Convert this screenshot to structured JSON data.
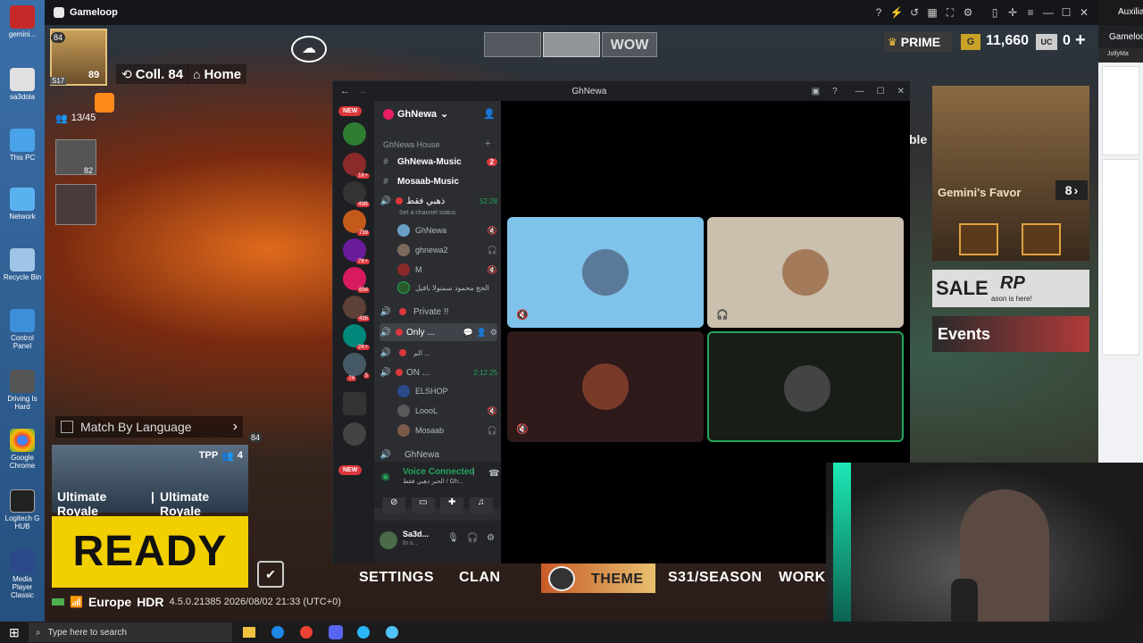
{
  "game_window": {
    "title": "Gameloop"
  },
  "aux_window": {
    "title": "Auxilia",
    "header": "Gameloo",
    "tab": "JollyMa"
  },
  "desktop_icons": [
    {
      "label": "gemini..."
    },
    {
      "label": "sa3dola"
    },
    {
      "label": "This PC"
    },
    {
      "label": "Network"
    },
    {
      "label": "Recycle Bin"
    },
    {
      "label": "Control Panel"
    },
    {
      "label": "Driving Is Hard"
    },
    {
      "label": "Google Chrome"
    },
    {
      "label": "Logitech G HUB"
    },
    {
      "label": "Media Player Classic"
    }
  ],
  "game_hud": {
    "player_level": "84",
    "player_rank": "89",
    "season": "S17",
    "coll": "Coll. 84",
    "home": "Home",
    "party": "13/45",
    "slot_level": "82",
    "prime": "PRIME",
    "uc_bp": "11,660",
    "uc": "0",
    "match_by_language": "Match By Language",
    "mode_tag": "TPP",
    "squad": "4",
    "mode_1": "Ultimate Royale",
    "mode_2": "Ultimate Royale",
    "ready": "READY",
    "server": "Europe",
    "hdr": "HDR",
    "version": "4.5.0.21385 2026/08/02 21:33 (UTC+0)",
    "top_tab": "WOW",
    "gemini_favor": "Gemini's Favor",
    "gemini_count": "8",
    "sale": "SALE",
    "rp": "RP",
    "rp_sub": "ason is here!",
    "events": "Events",
    "side_text": "ble",
    "menu": [
      "SETTINGS",
      "CLAN",
      "THEME",
      "S31/SEASON",
      "WORKSH"
    ]
  },
  "discord": {
    "window_title": "GhNewa",
    "server_name": "GhNewa",
    "category": "GhNewa House",
    "new_badge": "NEW",
    "channels": [
      {
        "name": "GhNewa-Music",
        "badge": "2"
      },
      {
        "name": "Mosaab-Music"
      }
    ],
    "voice_1": {
      "name": "ذهبي فقط",
      "time": "52:28",
      "status": "Set a channel status"
    },
    "voice_1_users": [
      "GhNewa",
      "ghnewa2",
      "M",
      "الحج محمود سمنولا بافيل"
    ],
    "voice_private": "Private !!",
    "voice_only": "Only ...",
    "voice_ar": "الم ...",
    "voice_on": {
      "name": "ON ...",
      "time": "2:12:25"
    },
    "voice_on_users": [
      "ELSHOP",
      "LoooL",
      "Mosaab"
    ],
    "voice_ghnewa": "GhNewa",
    "guild_badges": [
      "1K+",
      "49B",
      "739",
      "7K+",
      "654",
      "435",
      "2K+",
      "5",
      "74"
    ],
    "voice_connected": "Voice Connected",
    "voice_connected_sub": "الحبر ذهبي فقط / Gh...",
    "user_name": "Sa3d...",
    "user_status": "In v..."
  },
  "taskbar": {
    "search_placeholder": "Type here to search"
  }
}
